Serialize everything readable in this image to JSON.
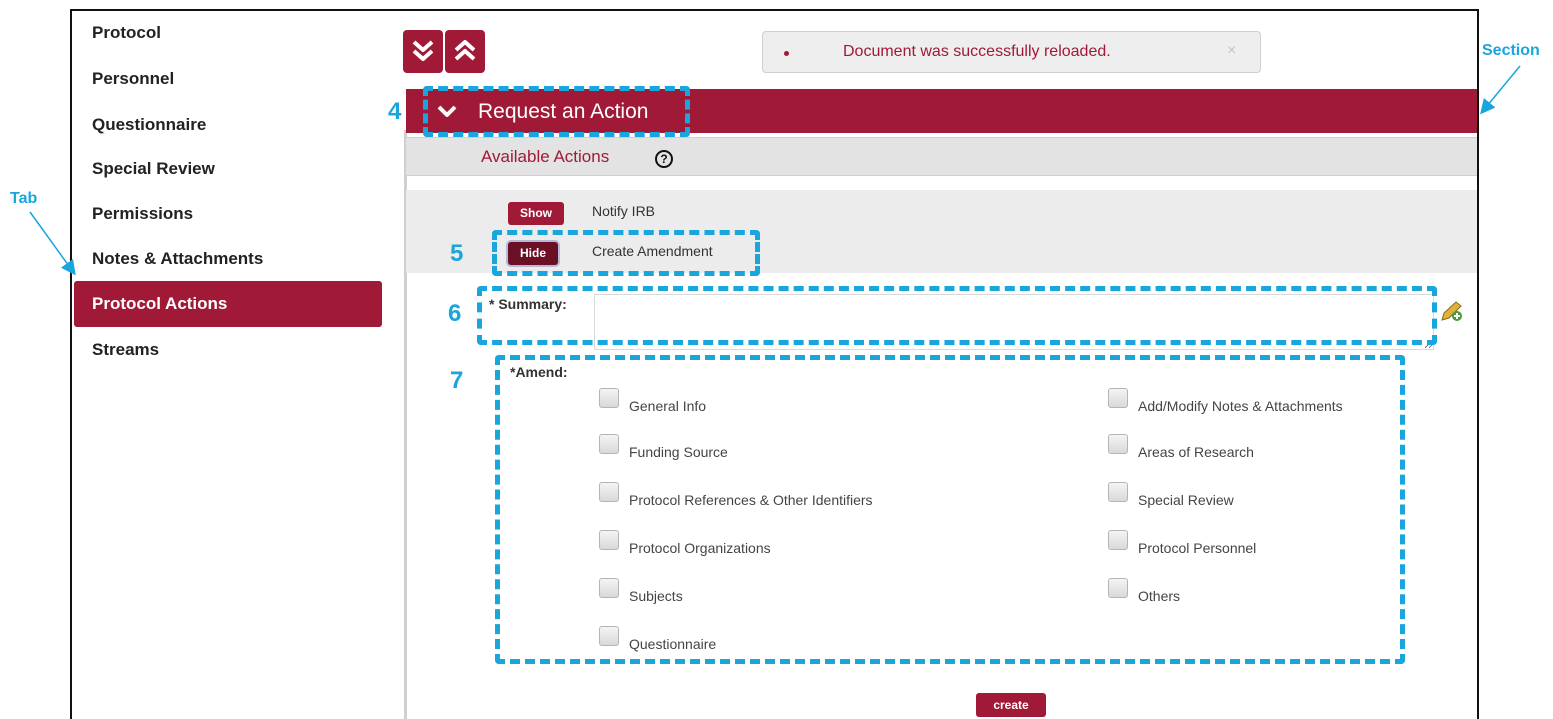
{
  "sidebar": {
    "items": [
      {
        "label": "Protocol"
      },
      {
        "label": "Personnel"
      },
      {
        "label": "Questionnaire"
      },
      {
        "label": "Special Review"
      },
      {
        "label": "Permissions"
      },
      {
        "label": "Notes & Attachments"
      },
      {
        "label": "Protocol Actions",
        "active": true
      },
      {
        "label": "Streams"
      }
    ]
  },
  "alert": {
    "message": "Document was successfully reloaded.",
    "close": "×"
  },
  "section": {
    "title": "Request an Action"
  },
  "available_actions": {
    "label": "Available Actions",
    "help": "?"
  },
  "actions": [
    {
      "button": "Show",
      "label": "Notify IRB"
    },
    {
      "button": "Hide",
      "label": "Create Amendment"
    }
  ],
  "summary": {
    "label": "* Summary:",
    "value": ""
  },
  "amend": {
    "label": "*Amend:",
    "left": [
      "General Info",
      "Funding Source",
      "Protocol References & Other Identifiers",
      "Protocol Organizations",
      "Subjects",
      "Questionnaire"
    ],
    "right": [
      "Add/Modify Notes & Attachments",
      "Areas of Research",
      "Special Review",
      "Protocol Personnel",
      "Others"
    ]
  },
  "create_button": "create",
  "annotations": {
    "tab": "Tab",
    "section": "Section",
    "n4": "4",
    "n5": "5",
    "n6": "6",
    "n7": "7"
  },
  "colors": {
    "brand": "#a01a37",
    "annotation": "#19a6dd"
  }
}
